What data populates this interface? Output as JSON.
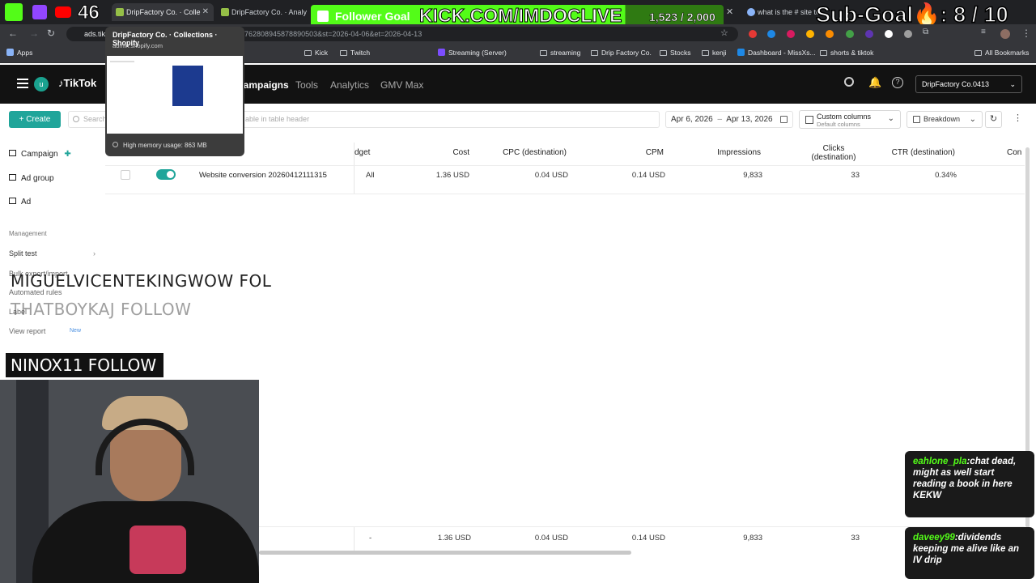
{
  "browser": {
    "tabs": [
      {
        "label": "",
        "active": false
      },
      {
        "label": "DripFactory Co. · Colle",
        "active": true
      },
      {
        "label": "DripFactory Co. · Analy",
        "active": false
      },
      {
        "label": "what is the # site to",
        "active": false
      }
    ],
    "address": {
      "host": "ads.tik",
      "url_rest": "762808945878890503&st=2026-04-06&et=2026-04-13"
    },
    "bookmarks": [
      "Apps",
      "Kick",
      "Twitch",
      "Streaming (Server)",
      "streaming",
      "Drip Factory Co.",
      "Stocks",
      "kenji",
      "Dashboard - MissXs...",
      "shorts & tiktok",
      "All Bookmarks"
    ],
    "tab_preview": {
      "title": "DripFactory Co. · Collections · Shopify",
      "domain": "admin.shopify.com",
      "memory": "High memory usage: 863 MB"
    }
  },
  "header": {
    "brand": "TikTok",
    "nav": [
      {
        "label": "Campaigns",
        "active": true
      },
      {
        "label": "Tools",
        "active": false
      },
      {
        "label": "Analytics",
        "active": false
      },
      {
        "label": "GMV Max",
        "active": false
      }
    ],
    "account": "DripFactory Co.0413"
  },
  "toolbar": {
    "create_label": "+ Create",
    "search_placeholder": "Search",
    "search_tail": "able in table header",
    "date_start": "Apr 6, 2026",
    "date_sep": "–",
    "date_end": "Apr 13, 2026",
    "custom_columns": "Custom columns",
    "custom_columns_sub": "Default columns",
    "breakdown": "Breakdown"
  },
  "sidebar": {
    "levels": [
      "Campaign",
      "Ad group",
      "Ad"
    ],
    "section": "Management",
    "management": [
      "Split test",
      "Bulk export/import",
      "Automated rules",
      "Label",
      "View report"
    ],
    "new_badge": "New"
  },
  "table": {
    "columns": [
      "dget",
      "Cost",
      "CPC (destination)",
      "CPM",
      "Impressions",
      "Clicks (destination)",
      "CTR (destination)",
      "Con"
    ],
    "row": {
      "name": "Website conversion 20260412111315",
      "budget": "All",
      "cost": "1.36 USD",
      "cpc": "0.04 USD",
      "cpm": "0.14 USD",
      "impressions": "9,833",
      "clicks": "33",
      "ctr": "0.34%",
      "enabled": true
    },
    "total": {
      "budget": "-",
      "cost": "1.36 USD",
      "cpc": "0.04 USD",
      "cpm": "0.14 USD",
      "impressions": "9,833",
      "clicks": "33"
    }
  },
  "overlay": {
    "stream_count": "46",
    "follower_goal_label": "Follower Goal",
    "kick_url": "KICK.COM/IMDOCLIVE",
    "follower_count": "1,523 / 2,000",
    "follower_progress": 0.7615,
    "sub_goal": "Sub-Goal",
    "sub_count": ": 8 / 10",
    "tickers": [
      "MIGUELVICENTEKINGWOW  FOL",
      "THATBOYKAJ  FOLLOW"
    ],
    "ninox": "NINOX11  FOLLOW",
    "chat": [
      {
        "user": "eahlone_pla",
        "text": ":chat dead, might as well start reading a book in here KEKW"
      },
      {
        "user": "daveey99",
        "text": ":dividends keeping me alive like an IV drip"
      }
    ]
  },
  "colors": {
    "kick_green": "#53fc18",
    "tiktok_teal": "#20a59a",
    "header_bg": "#121212"
  }
}
